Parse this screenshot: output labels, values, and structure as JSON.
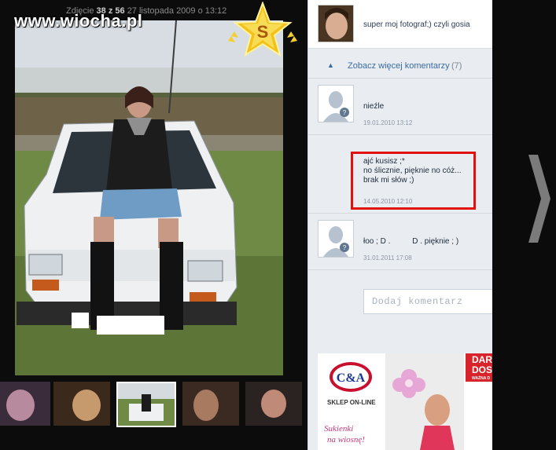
{
  "viewer": {
    "watermark": "www.wiocha.pl",
    "photo_label": "Zdjęcie",
    "photo_index": "38 z 56",
    "photo_date": "27 listopada 2009 o 13:12",
    "badge_letter": "S"
  },
  "thumbnails": [
    {
      "name": "thumb-1"
    },
    {
      "name": "thumb-2"
    },
    {
      "name": "thumb-3",
      "active": true
    },
    {
      "name": "thumb-4"
    },
    {
      "name": "thumb-5"
    }
  ],
  "comments_panel": {
    "top_comment": "super moj fotograf;) czyli gosia",
    "more_comments_label": "Zobacz więcej komentarzy",
    "more_comments_count": "(7)",
    "comments": [
      {
        "lines": [
          "nieźle"
        ],
        "date": "19.01.2010 13:12"
      },
      {
        "lines": [
          "ajć kusisz ;*",
          "no ślicznie, pięknie no cóż...",
          "brak mi słów ;)"
        ],
        "date": "14.05.2010 12:10"
      },
      {
        "lines": [
          "łoo ; D .          D . pięknie ; )"
        ],
        "date": "31.01.2011 17:08"
      }
    ],
    "add_comment_placeholder": "Dodaj komentarz"
  },
  "ad": {
    "brand": "C&A",
    "shop_label": "SKLEP ON-LINE",
    "slogan_line1": "Sukienki",
    "slogan_line2": "na wiosnę!",
    "promo_line1": "DAR",
    "promo_line2": "DOS",
    "promo_small": "WAŻNA D"
  },
  "colors": {
    "highlight_box": "#e01010",
    "link_blue": "#3b6aa0",
    "panel_bg": "#e9edf1"
  }
}
